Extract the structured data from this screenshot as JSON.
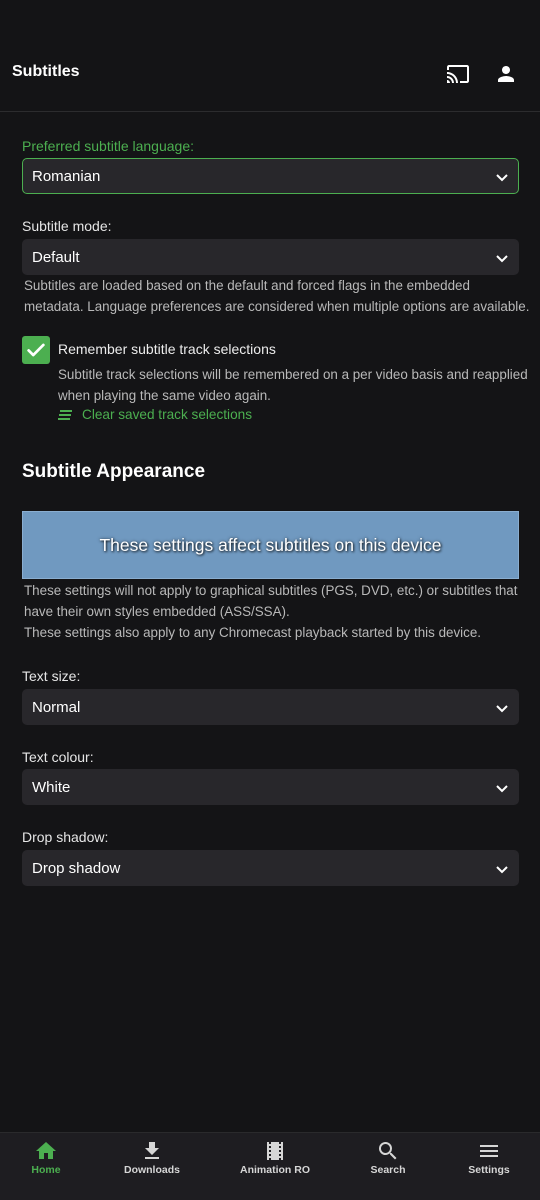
{
  "header": {
    "title": "Subtitles",
    "icons": [
      "cast-icon",
      "account-icon"
    ]
  },
  "subtitle_settings": {
    "preferred_language": {
      "label": "Preferred subtitle language:",
      "value": "Romanian"
    },
    "mode": {
      "label": "Subtitle mode:",
      "value": "Default",
      "helper_line1": "Subtitles are loaded based on the default and forced flags in the embedded",
      "helper_line2": "metadata. Language preferences are considered when multiple options are available."
    },
    "remember": {
      "label": "Remember subtitle track selections",
      "checked": true,
      "helper_line1": "Subtitle track selections will be remembered on a per video basis and reapplied",
      "helper_line2": "when playing the same video again.",
      "clear_label": "Clear saved track selections"
    }
  },
  "appearance": {
    "title": "Subtitle Appearance",
    "preview_text": "These settings affect subtitles on this device",
    "note_line1": "These settings will not apply to graphical subtitles (PGS, DVD, etc.) or subtitles that",
    "note_line2": "have their own styles embedded (ASS/SSA).",
    "note_line3": "These settings also apply to any Chromecast playback started by this device.",
    "text_size": {
      "label": "Text size:",
      "value": "Normal"
    },
    "text_colour": {
      "label": "Text colour:",
      "value": "White"
    },
    "drop_shadow": {
      "label": "Drop shadow:",
      "value": "Drop shadow"
    }
  },
  "colors": {
    "accent": "#4caf50",
    "preview_bg": "#7099c0",
    "background": "#141416",
    "field_bg": "#28272b"
  },
  "bottom_nav": {
    "home": "Home",
    "downloads": "Downloads",
    "animation": "Animation RO",
    "search": "Search",
    "settings": "Settings",
    "active": "home"
  }
}
